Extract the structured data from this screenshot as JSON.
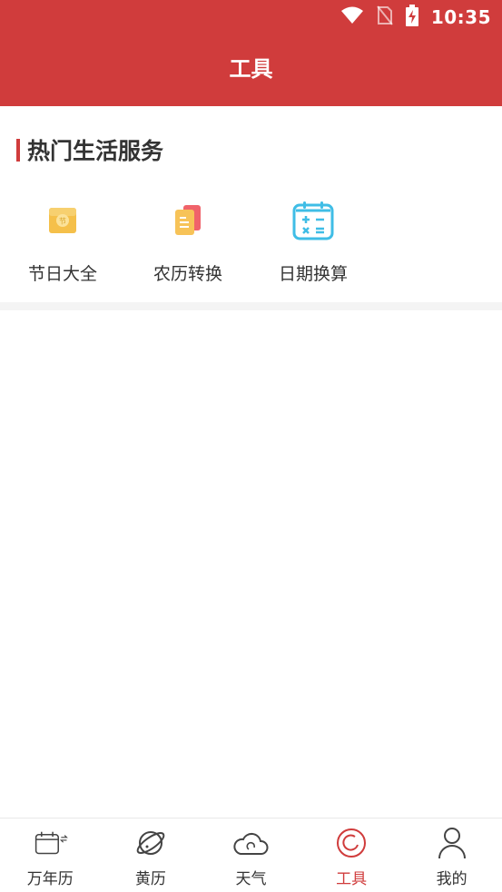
{
  "status_bar": {
    "time": "10:35"
  },
  "header": {
    "title": "工具"
  },
  "section": {
    "title": "热门生活服务",
    "tools": [
      {
        "label": "节日大全",
        "icon": "red-envelope-icon"
      },
      {
        "label": "农历转换",
        "icon": "document-stack-icon"
      },
      {
        "label": "日期换算",
        "icon": "calculator-calendar-icon"
      }
    ]
  },
  "bottom_nav": {
    "items": [
      {
        "label": "万年历",
        "icon": "calendar-icon"
      },
      {
        "label": "黄历",
        "icon": "planet-icon"
      },
      {
        "label": "天气",
        "icon": "cloud-icon"
      },
      {
        "label": "工具",
        "icon": "tool-circle-icon",
        "active": true
      },
      {
        "label": "我的",
        "icon": "user-icon"
      }
    ]
  },
  "colors": {
    "brand_red": "#d03c3c",
    "text_dark": "#333333",
    "icon_gold": "#f5c04a",
    "icon_blue": "#3fbde6"
  }
}
